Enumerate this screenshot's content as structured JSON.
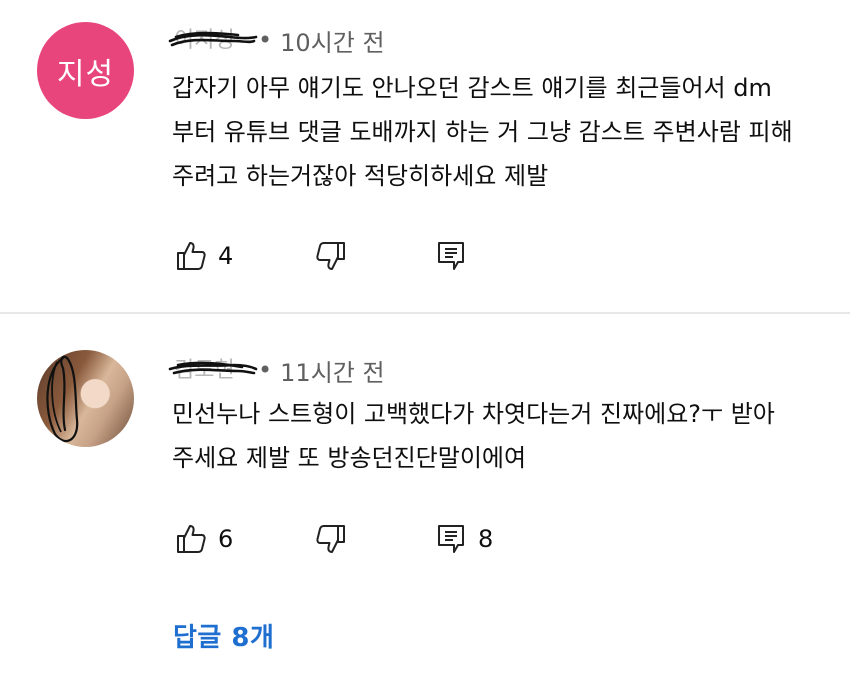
{
  "comments": [
    {
      "avatar_text": "지성",
      "avatar_color": "#e8457c",
      "author": "이지성",
      "separator": "•",
      "time": "10시간 전",
      "text": "갑자기 아무 얘기도 안나오던 감스트 얘기를 최근들어서 dm\n부터 유튜브 댓글 도배까지 하는 거 그냥 감스트 주변사람 피해\n주려고 하는거잖아 적당히하세요 제발",
      "likes": "4",
      "replies": ""
    },
    {
      "avatar_text": "",
      "author": "김도현",
      "separator": "•",
      "time": "11시간 전",
      "text": "민선누나 스트형이 고백했다가 차엿다는거 진짜에요?ㅜ 받아\n주세요 제발 또 방송던진단말이에여",
      "likes": "6",
      "replies": "8"
    }
  ],
  "replies_link": "답글 8개",
  "icons": {
    "like": "thumbs-up-icon",
    "dislike": "thumbs-down-icon",
    "reply": "reply-comment-icon"
  },
  "accent_color": "#1f6fd1"
}
